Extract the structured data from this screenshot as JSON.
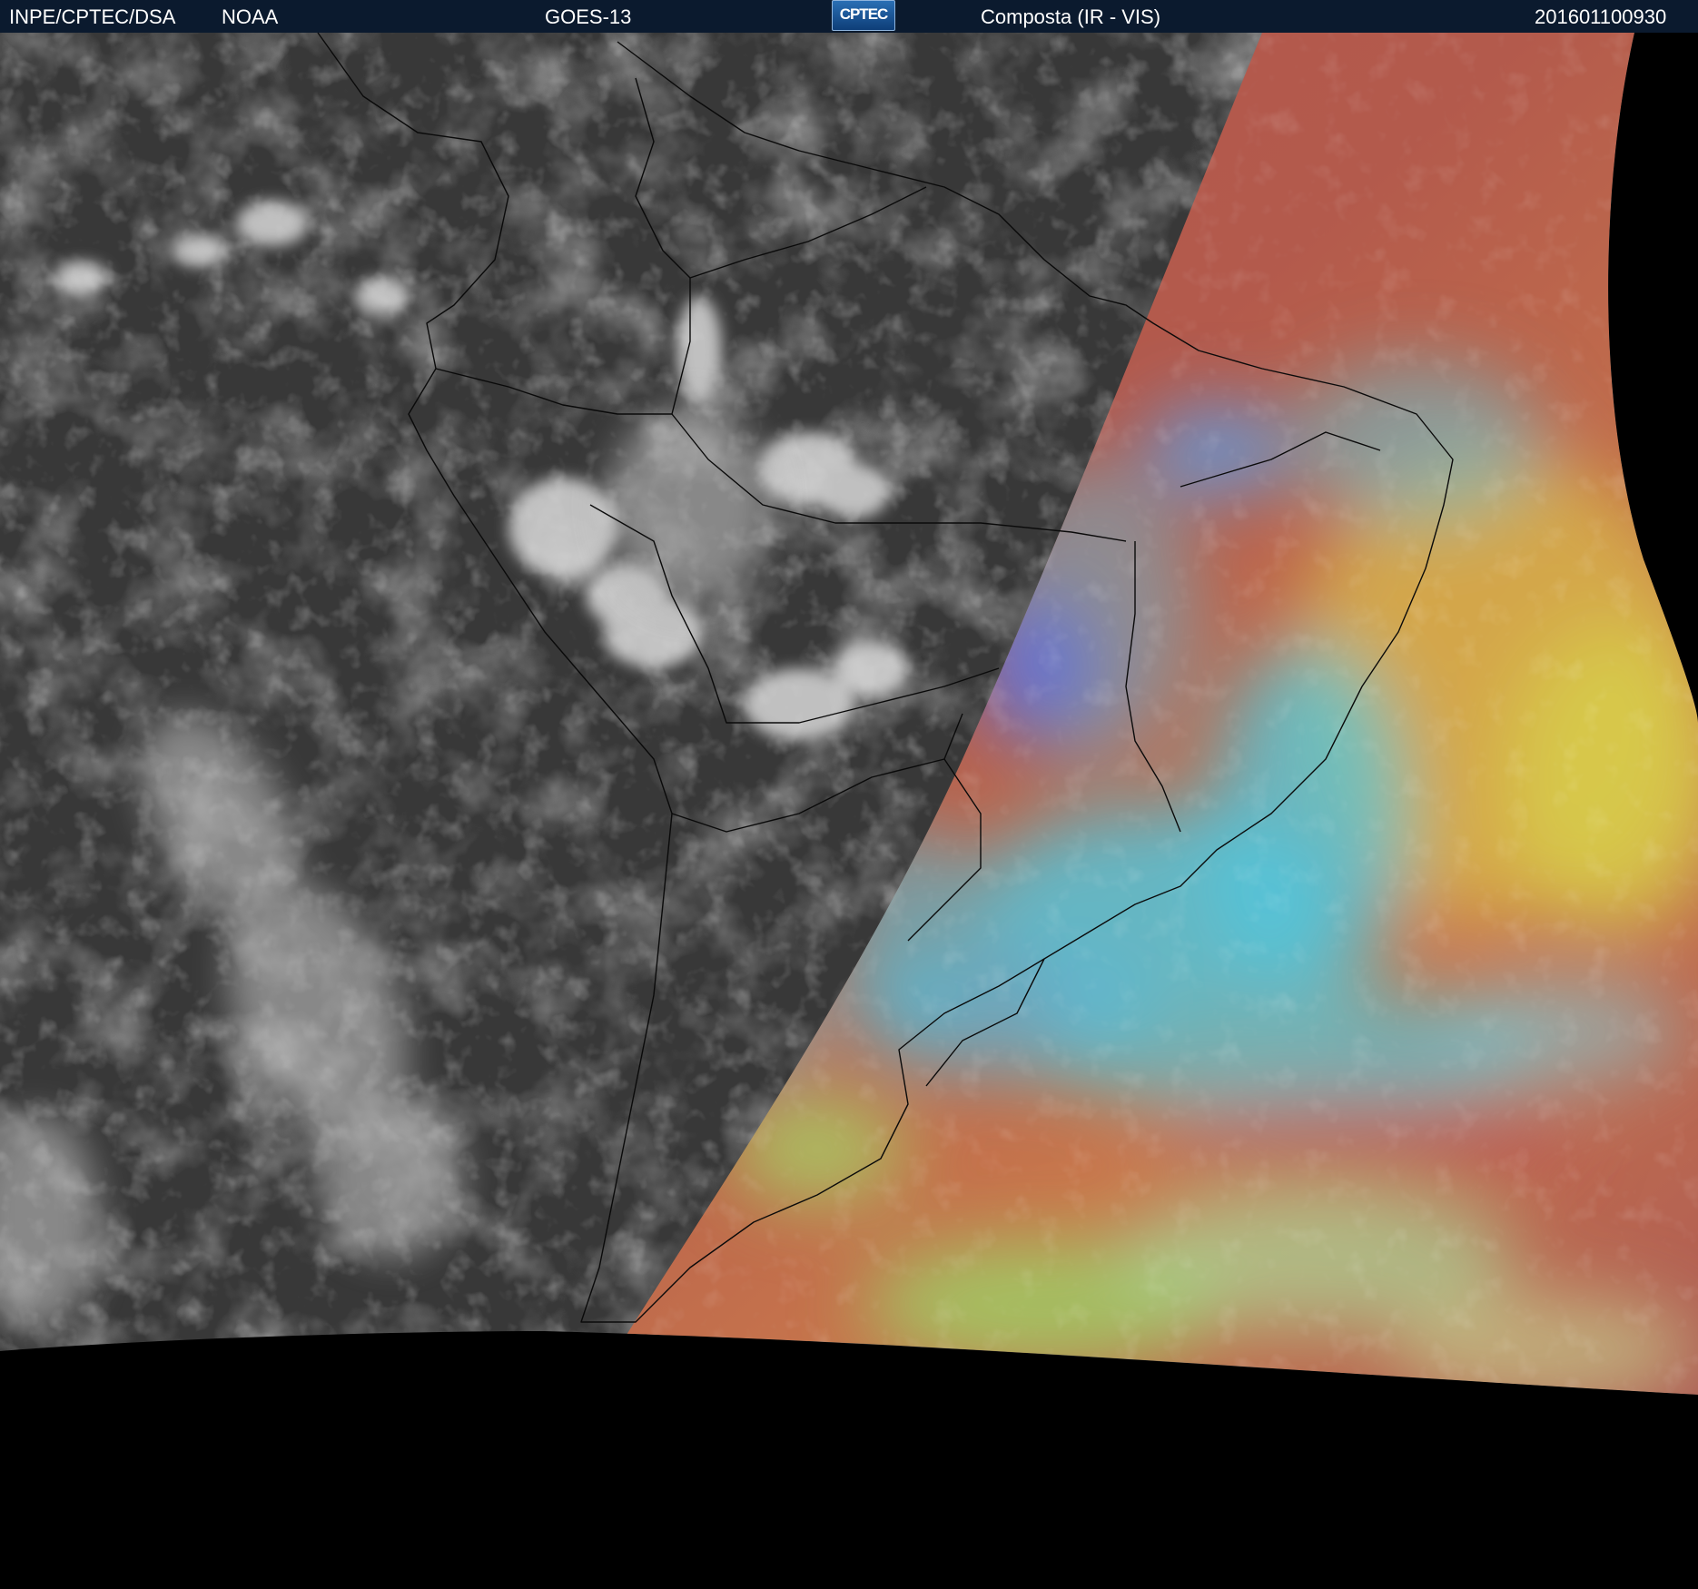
{
  "header": {
    "organization": "INPE/CPTEC/DSA",
    "agency": "NOAA",
    "satellite": "GOES-13",
    "logo_text": "CPTEC",
    "product": "Composta (IR - VIS)",
    "timestamp": "201601100930"
  },
  "colors": {
    "header_background": "#0b1a2e",
    "night_ir_background": "#3a3a3a",
    "space_background": "#000000",
    "day_composite_red": "#b2534e",
    "day_composite_cyan": "#4fc8e0",
    "day_composite_green": "#98d86a",
    "day_composite_yellow": "#d8b04a"
  }
}
